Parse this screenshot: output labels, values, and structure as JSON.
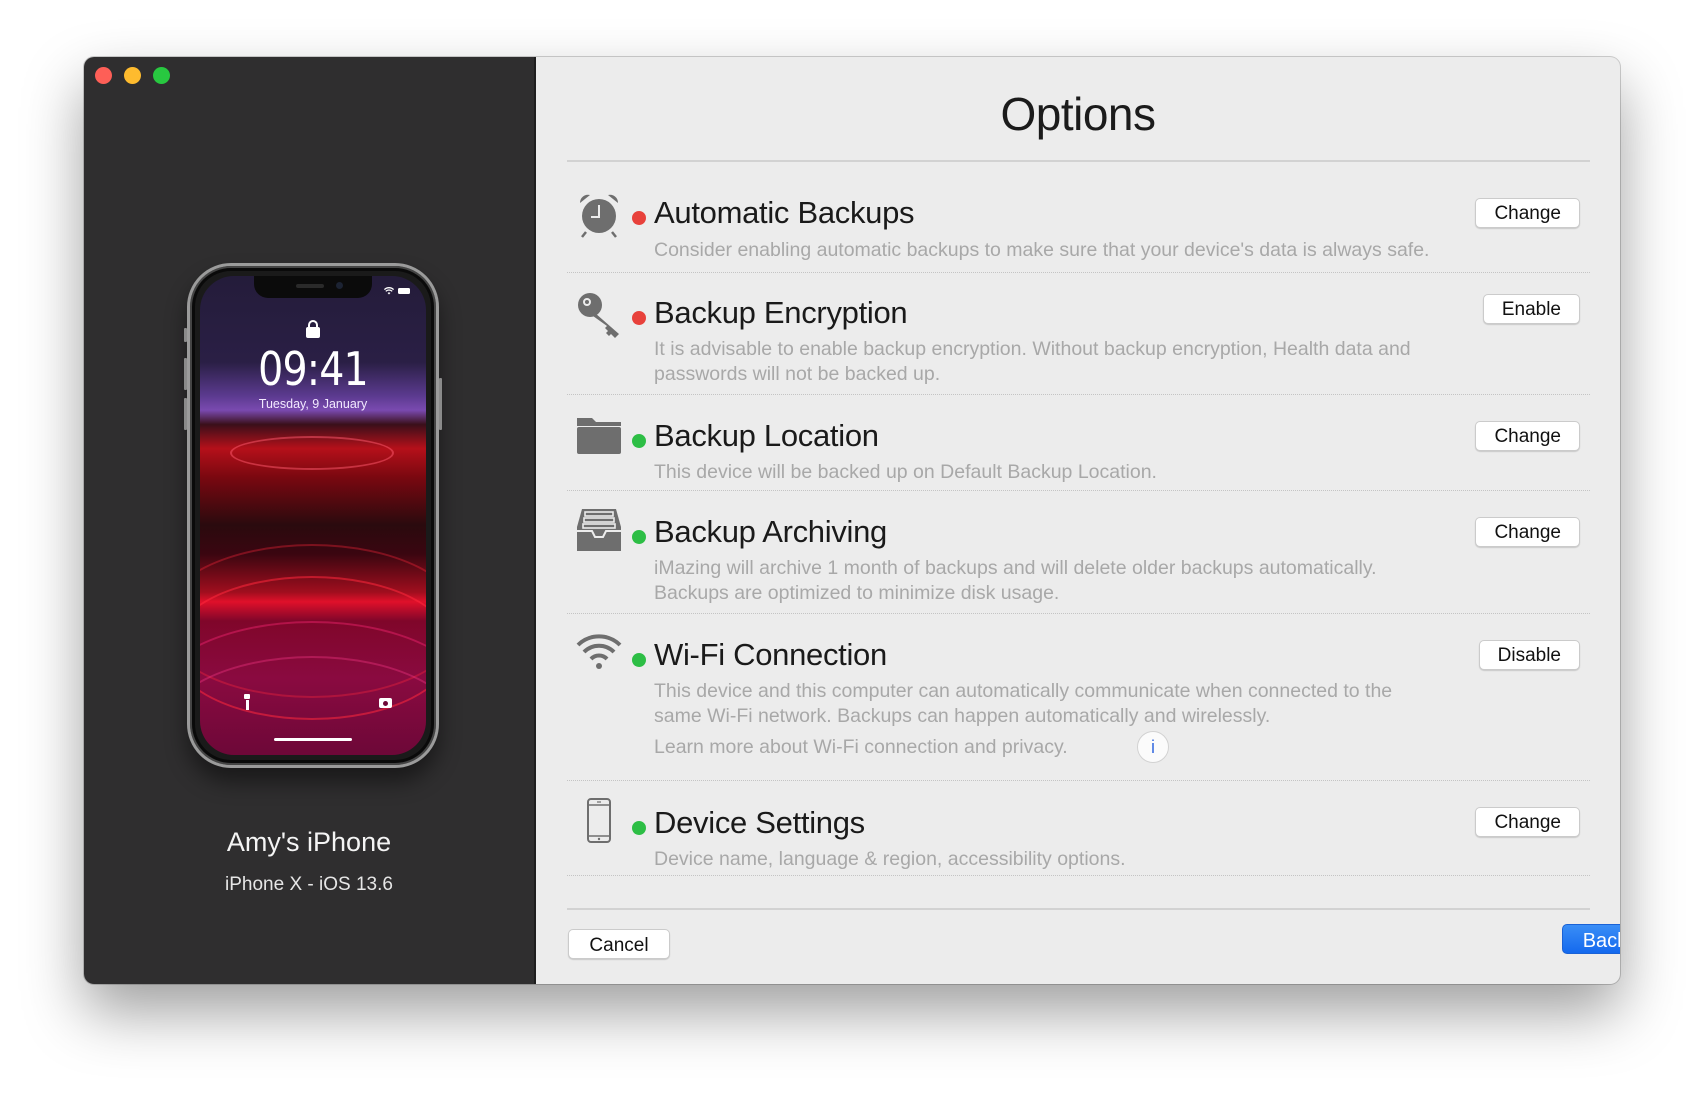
{
  "window": {
    "traffic_lights": [
      "close",
      "minimize",
      "zoom"
    ]
  },
  "device": {
    "name": "Amy's iPhone",
    "model_os": "iPhone X - iOS 13.6",
    "lock_screen": {
      "time": "09:41",
      "date": "Tuesday, 9 January"
    }
  },
  "header": {
    "title": "Options",
    "help_label": "?"
  },
  "colors": {
    "status_off": "#e8413b",
    "status_on": "#2dbe45",
    "accent": "#1a6cf0"
  },
  "options": [
    {
      "icon": "alarm-clock-icon",
      "status": "off",
      "title": "Automatic Backups",
      "description": "Consider enabling automatic backups to make sure that your device's data is always safe.",
      "button": "Change"
    },
    {
      "icon": "key-icon",
      "status": "off",
      "title": "Backup Encryption",
      "description": "It is advisable to enable backup encryption. Without backup encryption, Health data and passwords will not be backed up.",
      "button": "Enable"
    },
    {
      "icon": "folder-icon",
      "status": "on",
      "title": "Backup Location",
      "description": "This device will be backed up on Default Backup Location.",
      "button": "Change"
    },
    {
      "icon": "archive-tray-icon",
      "status": "on",
      "title": "Backup Archiving",
      "description": "iMazing will archive 1 month of backups and will delete older backups automatically. Backups are optimized to minimize disk usage.",
      "button": "Change"
    },
    {
      "icon": "wifi-icon",
      "status": "on",
      "title": "Wi-Fi Connection",
      "description": "This device and this computer can automatically communicate when connected to the same Wi-Fi network. Backups can happen automatically and wirelessly.",
      "link": "Learn more about Wi-Fi connection and privacy.",
      "info_label": "i",
      "button": "Disable"
    },
    {
      "icon": "phone-device-icon",
      "status": "on",
      "title": "Device Settings",
      "description": "Device name, language & region, accessibility options.",
      "button": "Change"
    }
  ],
  "footer": {
    "cancel_label": "Cancel",
    "backup_label": "Back Up"
  }
}
